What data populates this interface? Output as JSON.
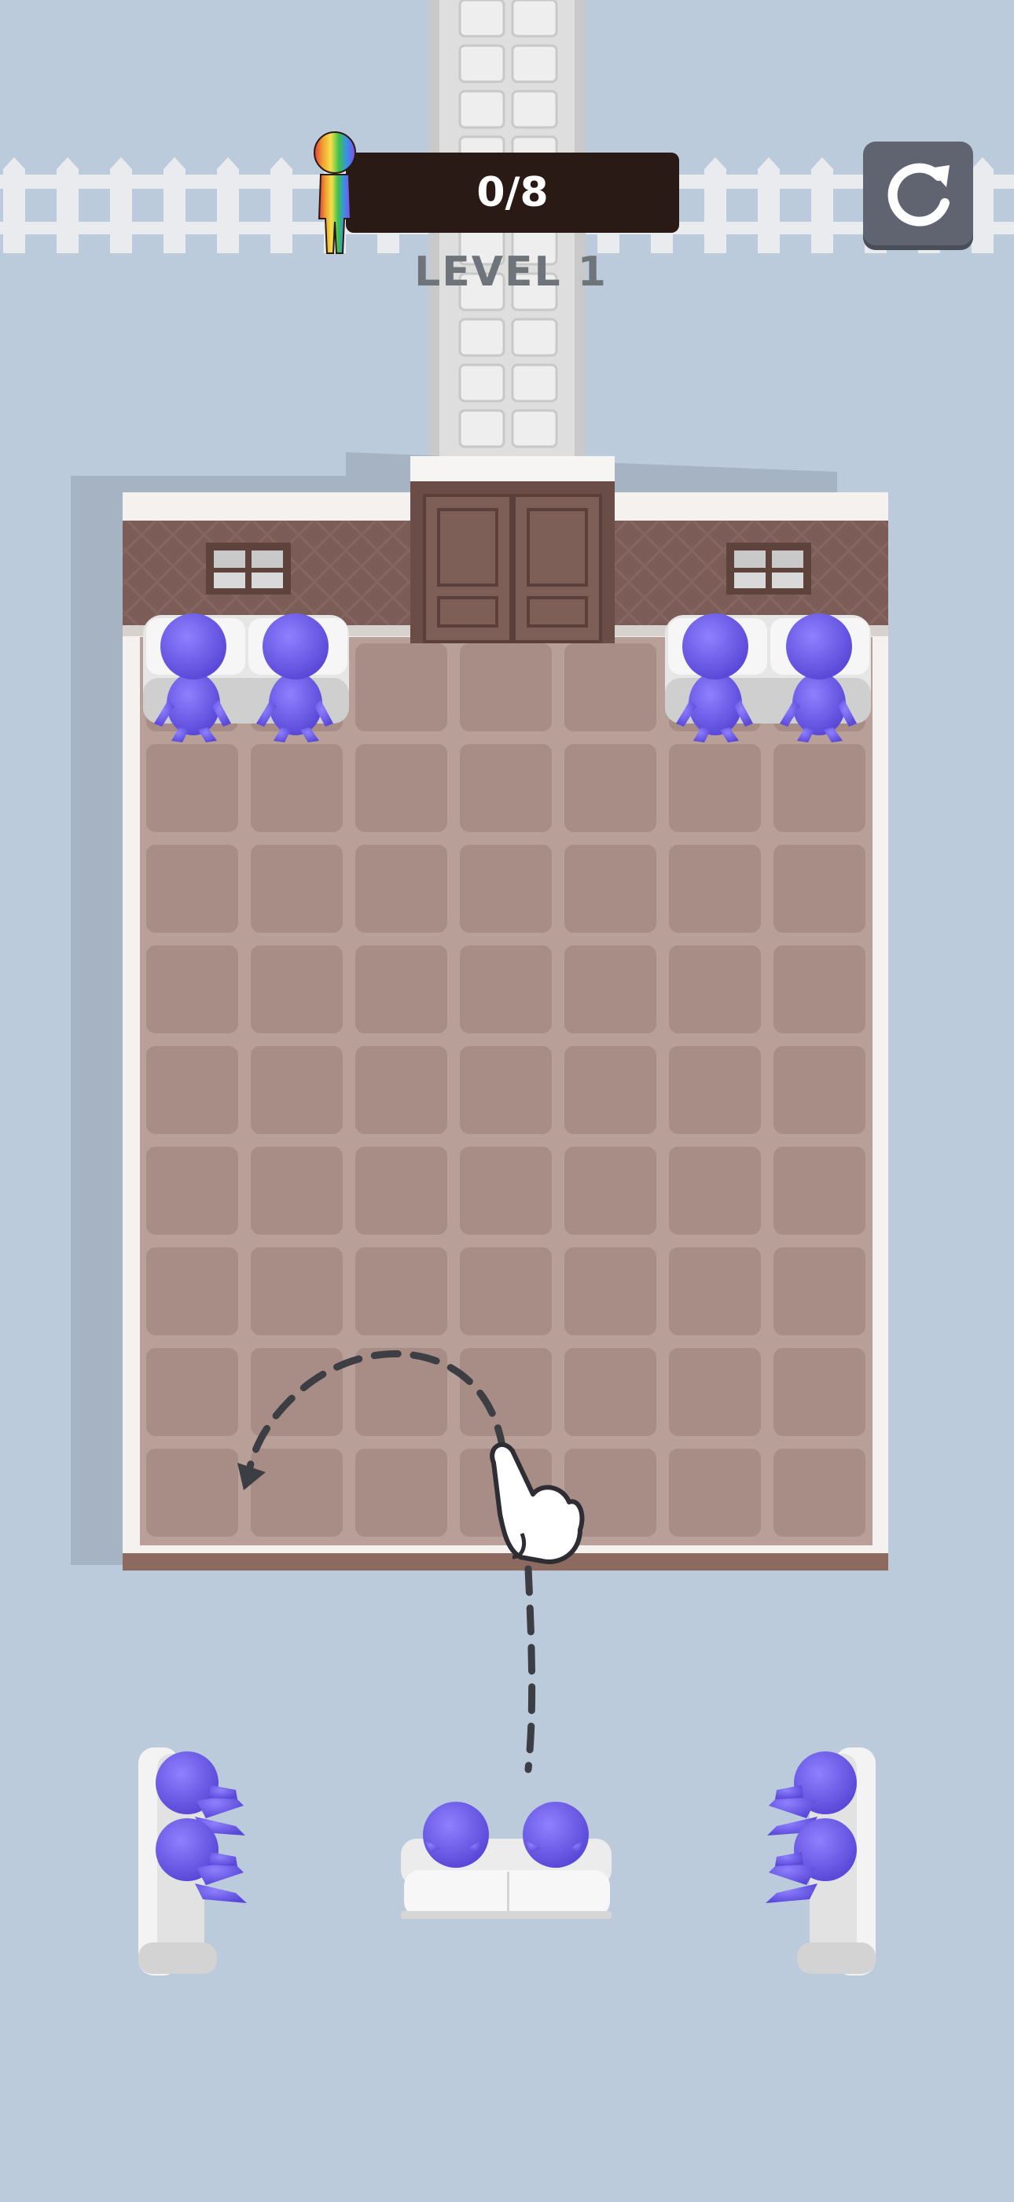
{
  "hud": {
    "progress_text": "0/8",
    "level_text": "LEVEL 1",
    "restart_icon": "restart-icon",
    "progress_icon": "rainbow-stickman-icon"
  },
  "game": {
    "seated_count": 0,
    "total_seats": 8,
    "character_color": "#7b68f0",
    "floor_color": "#b89f98",
    "wall_color": "#7c5e58",
    "background_color": "#bccbdb",
    "tutorial_icon": "pointing-hand-icon"
  }
}
